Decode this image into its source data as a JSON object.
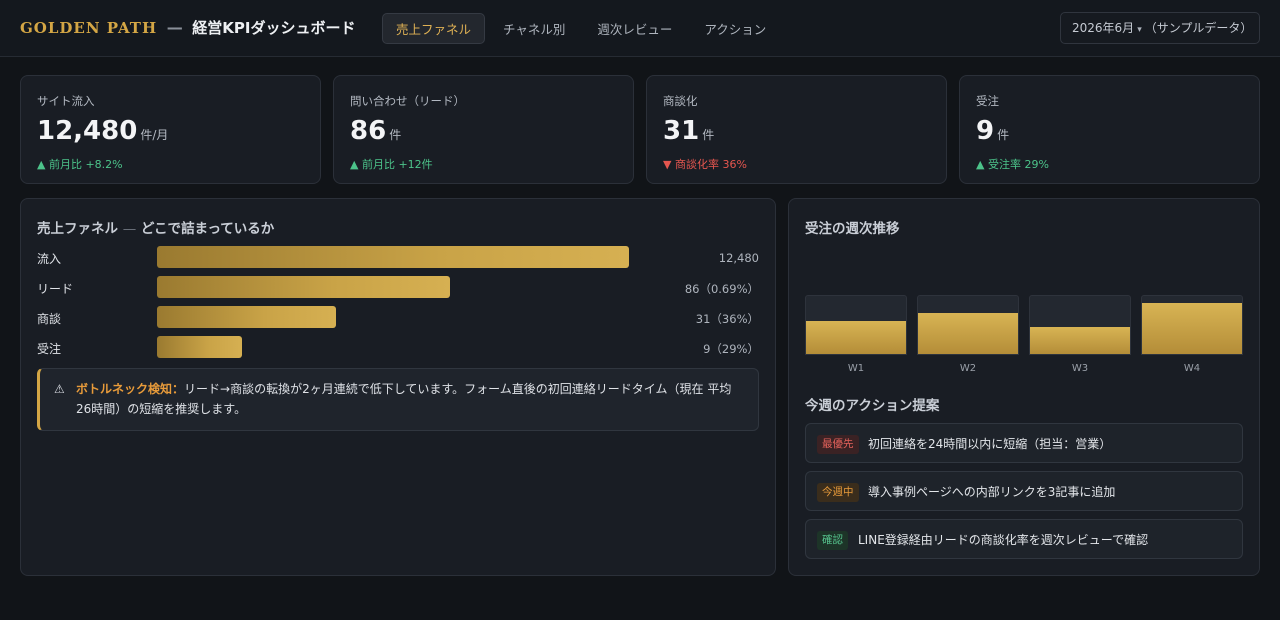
{
  "header": {
    "brand": "GOLDEN PATH",
    "separator": "—",
    "title": "経営KPIダッシュボード",
    "tabs": [
      {
        "label": "売上ファネル",
        "active": true
      },
      {
        "label": "チャネル別",
        "active": false
      },
      {
        "label": "週次レビュー",
        "active": false
      },
      {
        "label": "アクション",
        "active": false
      }
    ],
    "period": {
      "month": "2026年6月",
      "note": "（サンプルデータ）"
    }
  },
  "kpis": [
    {
      "label": "サイト流入",
      "value": "12,480",
      "unit": "件/月",
      "delta": "前月比 +8.2%",
      "trend": "up"
    },
    {
      "label": "問い合わせ（リード）",
      "value": "86",
      "unit": "件",
      "delta": "前月比 +12件",
      "trend": "up"
    },
    {
      "label": "商談化",
      "value": "31",
      "unit": "件",
      "delta": "商談化率 36%",
      "trend": "down"
    },
    {
      "label": "受注",
      "value": "9",
      "unit": "件",
      "delta": "受注率 29%",
      "trend": "up"
    }
  ],
  "funnel": {
    "title": "売上ファネル",
    "title_sep": "—",
    "subtitle": "どこで詰まっているか",
    "rows": [
      {
        "label": "流入",
        "display": "12,480",
        "bar_fraction": 1.0
      },
      {
        "label": "リード",
        "display": "86（0.69%）",
        "bar_fraction": 0.62
      },
      {
        "label": "商談",
        "display": "31（36%）",
        "bar_fraction": 0.38
      },
      {
        "label": "受注",
        "display": "9（29%）",
        "bar_fraction": 0.18
      }
    ],
    "alert": {
      "icon": "warning-icon",
      "head": "ボトルネック検知：",
      "text": "リード→商談の転換が2ヶ月連続で低下しています。フォーム直後の初回連絡リードタイム（現在 平均26時間）の短縮を推奨します。"
    }
  },
  "weekly": {
    "title": "受注の週次推移",
    "weeks": [
      {
        "label": "W1",
        "fraction": 0.57
      },
      {
        "label": "W2",
        "fraction": 0.71
      },
      {
        "label": "W3",
        "fraction": 0.47
      },
      {
        "label": "W4",
        "fraction": 0.88
      }
    ]
  },
  "actions": {
    "title": "今週のアクション提案",
    "items": [
      {
        "badge": "最優先",
        "tone": "red",
        "text": "初回連絡を24時間以内に短縮（担当：営業）"
      },
      {
        "badge": "今週中",
        "tone": "orange",
        "text": "導入事例ページへの内部リンクを3記事に追加"
      },
      {
        "badge": "確認",
        "tone": "green",
        "text": "LINE登録経由リードの商談化率を週次レビューで確認"
      }
    ]
  },
  "colors": {
    "gold": "#d4a645",
    "up": "#4cc38a",
    "down": "#e5564f",
    "background": "#111418",
    "card": "#191d24"
  }
}
